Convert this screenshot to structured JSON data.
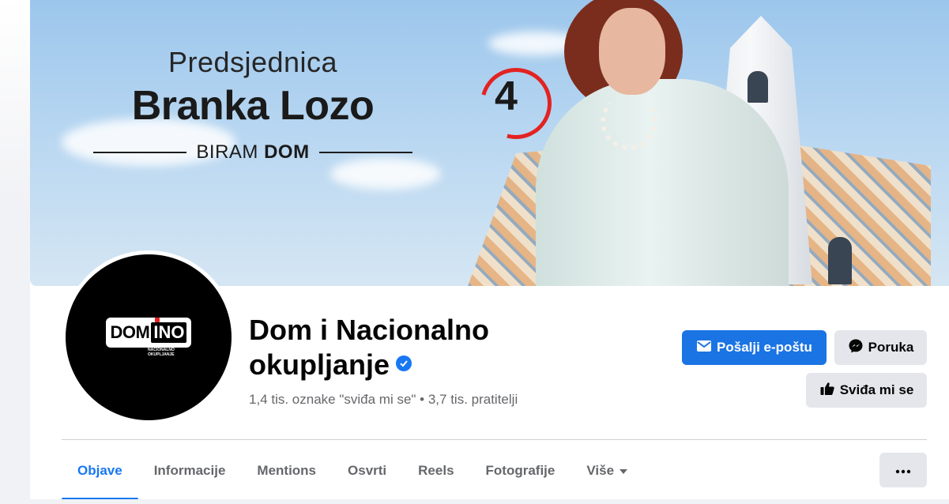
{
  "cover": {
    "kicker": "Predsjednica",
    "name": "Branka Lozo",
    "slogan_prefix": "BIRAM",
    "slogan_bold": "DOM",
    "ballot_number": "4"
  },
  "profile": {
    "logo_main": "DOM",
    "logo_accent": "INO",
    "logo_sub": "NACIONALNO OKUPLJANJE"
  },
  "page": {
    "name": "Dom i Nacionalno okupljanje",
    "verified": true,
    "stats": "1,4 tis. oznake \"sviđa mi se\" • 3,7 tis. pratitelji"
  },
  "actions": {
    "email": "Pošalji e-poštu",
    "message": "Poruka",
    "like": "Sviđa mi se"
  },
  "tabs": [
    {
      "label": "Objave",
      "active": true
    },
    {
      "label": "Informacije"
    },
    {
      "label": "Mentions"
    },
    {
      "label": "Osvrti"
    },
    {
      "label": "Reels"
    },
    {
      "label": "Fotografije"
    },
    {
      "label": "Više",
      "dropdown": true
    }
  ],
  "colors": {
    "accent": "#1877f2",
    "button_primary": "#1b74e4",
    "button_grey": "#e4e6eb",
    "muted_text": "#65676b"
  },
  "icons": {
    "email": "envelope-icon",
    "message": "messenger-icon",
    "like": "thumbs-up-icon",
    "more": "more-horizontal-icon",
    "dropdown": "caret-down-icon",
    "verified": "verified-badge-icon"
  }
}
